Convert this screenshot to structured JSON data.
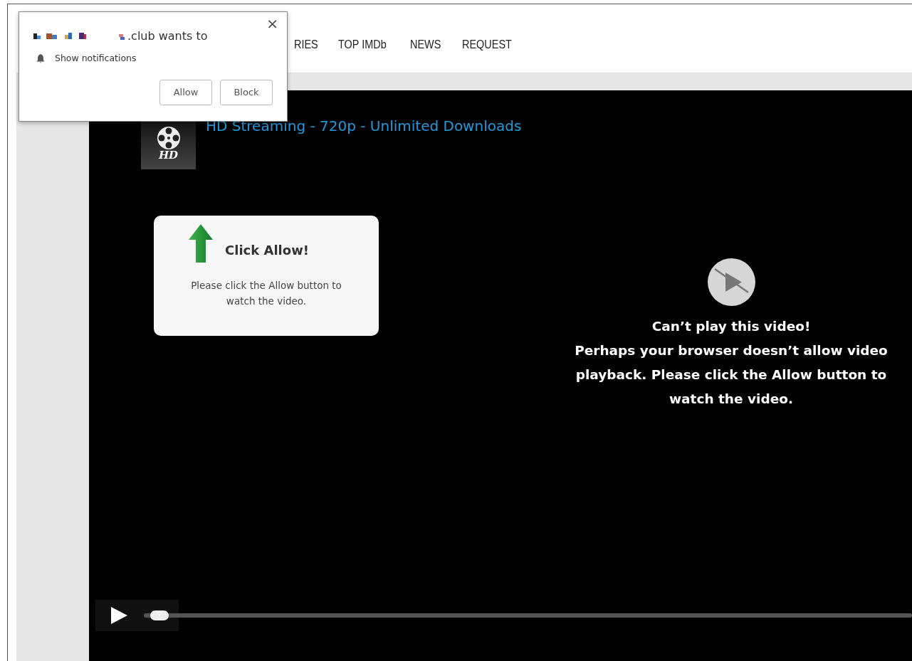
{
  "notification": {
    "site": ".club wants to",
    "permission": "Show notifications",
    "close": "×",
    "buttons": [
      {
        "label": "Allow"
      },
      {
        "label": "Block"
      }
    ]
  },
  "nav": [
    {
      "label": "RIES"
    },
    {
      "label": "TOP IMDb"
    },
    {
      "label": "NEWS"
    },
    {
      "label": "REQUEST"
    }
  ],
  "player": {
    "title": "HD Streaming - 720p - Unlimited Downloads",
    "logo_text": "HD",
    "prompt": {
      "title": "Click Allow!",
      "text": "Please click the Allow button to watch the video."
    },
    "error": {
      "title": "Can’t play this video!",
      "text": "Perhaps your browser doesn’t allow video playback. Please click the Allow button to watch the video."
    },
    "progress": {
      "level": 0.02
    }
  }
}
